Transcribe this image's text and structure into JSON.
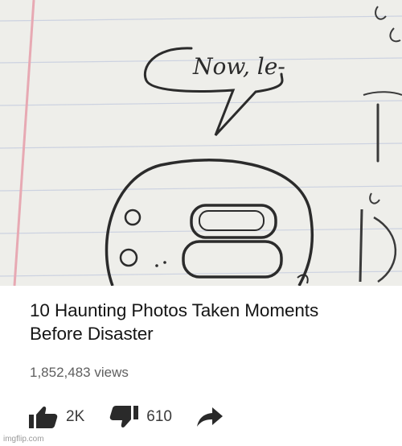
{
  "photo": {
    "speech_text": "Now, le-"
  },
  "video": {
    "title": "10 Haunting Photos Taken Moments Before Disaster",
    "views": "1,852,483 views",
    "likes": "2K",
    "dislikes": "610"
  },
  "icons": {
    "like": "thumbs-up-icon",
    "dislike": "thumbs-down-icon",
    "share": "share-arrow-icon"
  },
  "watermark": "imgflip.com"
}
